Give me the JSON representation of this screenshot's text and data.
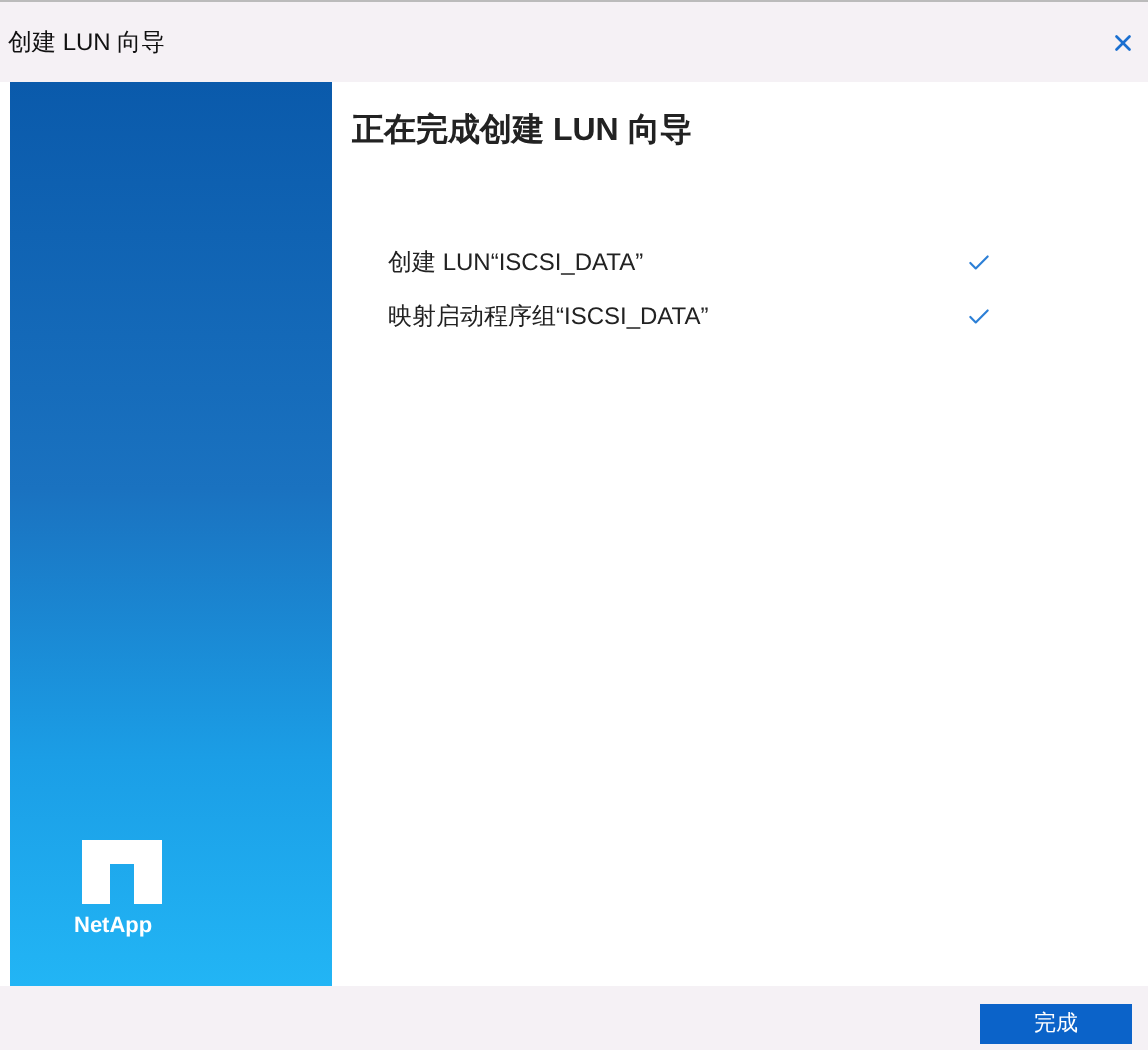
{
  "window": {
    "title": "创建 LUN 向导"
  },
  "heading": "正在完成创建 LUN 向导",
  "tasks": [
    {
      "label": "创建 LUN“ISCSI_DATA”",
      "done": true
    },
    {
      "label": "映射启动程序组“ISCSI_DATA”",
      "done": true
    }
  ],
  "logo": {
    "text": "NetApp"
  },
  "buttons": [
    {
      "label": "完成"
    }
  ]
}
